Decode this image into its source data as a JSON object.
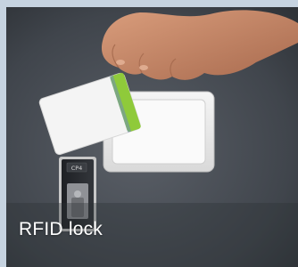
{
  "caption": "RFID lock",
  "lock": {
    "display_text": "CP4"
  },
  "colors": {
    "panel_bg": "#4b5058",
    "frame_bg": "#c6d3e0",
    "card_stripe": "#8fca3a",
    "card_body": "#f4f4f4",
    "reader_plate": "#ececec",
    "skin": "#c9896a"
  },
  "icons": [
    "rfid-card",
    "card-reader",
    "key-lock"
  ]
}
